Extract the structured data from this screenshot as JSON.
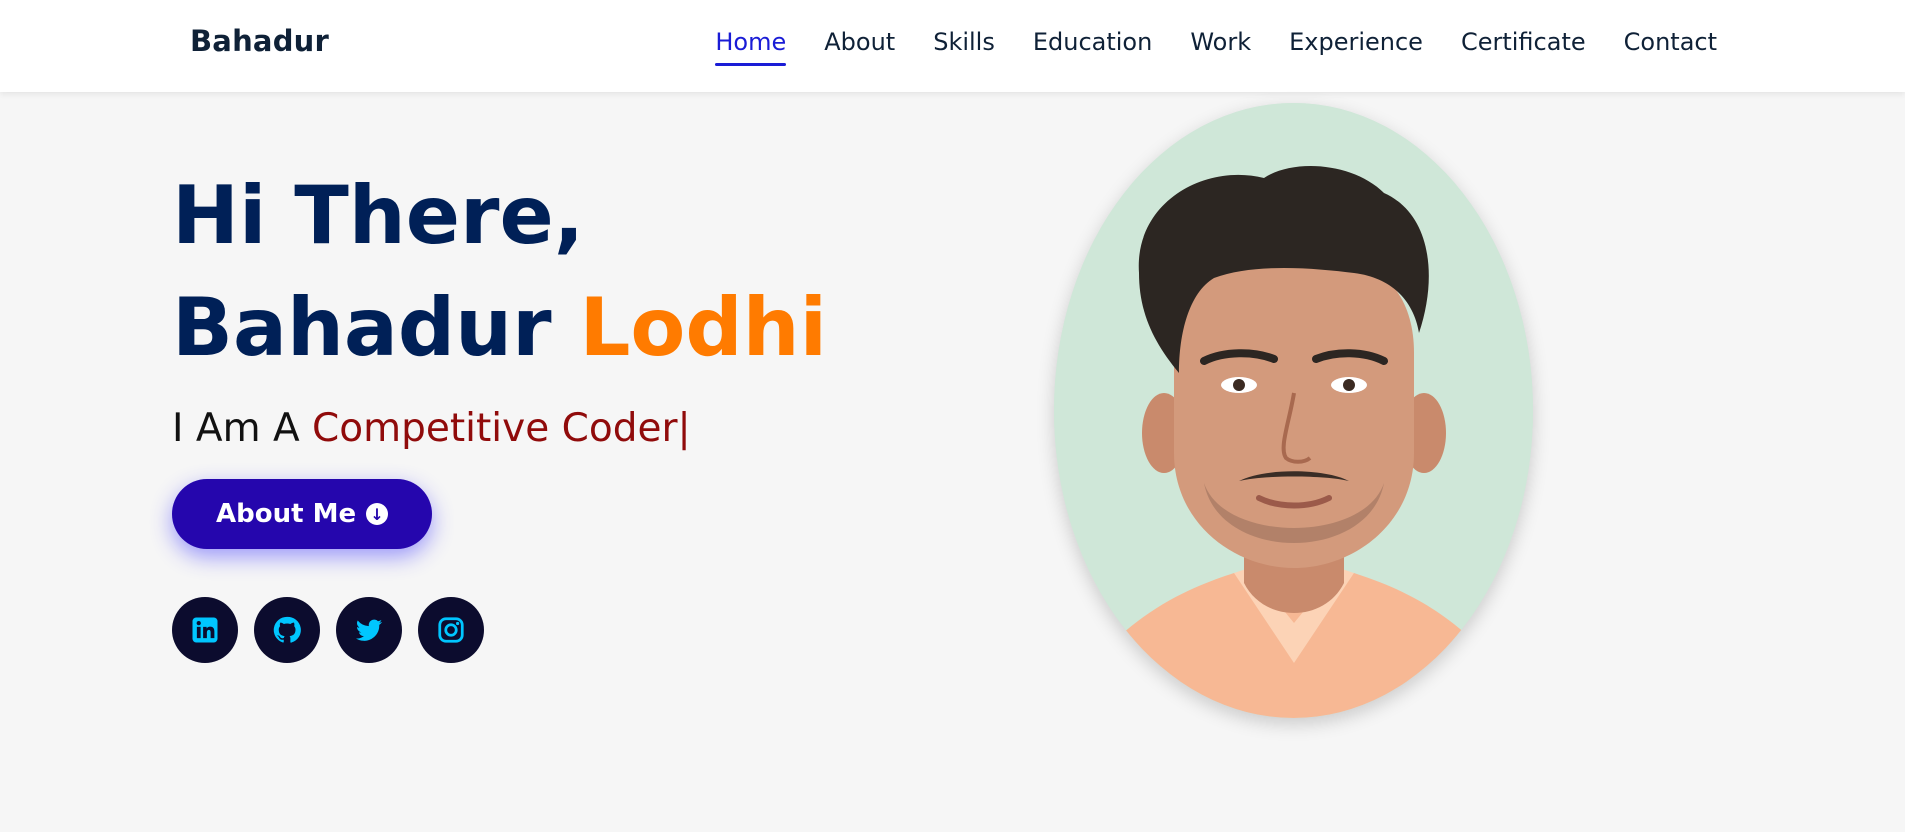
{
  "brand": "Bahadur",
  "nav": {
    "items": [
      "Home",
      "About",
      "Skills",
      "Education",
      "Work",
      "Experience",
      "Certificate",
      "Contact"
    ],
    "active": "Home"
  },
  "hero": {
    "greeting": "Hi There,",
    "first_name": "Bahadur",
    "last_name": "Lodhi",
    "typed_prefix": "I Am A ",
    "typed_role": "Competitive Coder|",
    "about_button": "About Me"
  },
  "social_icons": [
    "linkedin-icon",
    "github-icon",
    "twitter-icon",
    "instagram-icon"
  ],
  "colors": {
    "heading": "#002057",
    "accent_orange": "#ff7b00",
    "role_red": "#900b0b",
    "button": "#2506ad",
    "nav_active": "#1a1cd6",
    "social_bg": "#0c0c2e",
    "social_icon": "#00c6ff",
    "photo_bg": "#cfe7d8"
  }
}
